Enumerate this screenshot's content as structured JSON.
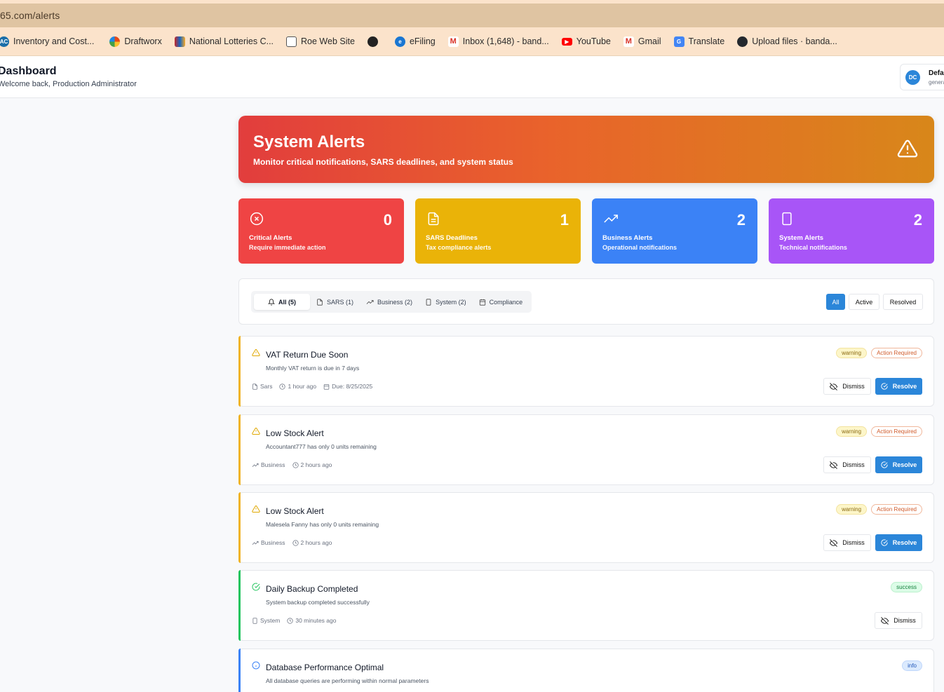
{
  "browser": {
    "url": "65.com/alerts",
    "bookmarks": [
      {
        "label": "Inventory and Cost...",
        "icon": "ac-icon",
        "color": "#1a6ea8"
      },
      {
        "label": "Draftworx",
        "icon": "draftworx-icon",
        "color": "#e64a19"
      },
      {
        "label": "National Lotteries C...",
        "icon": "lotteries-icon",
        "color": "#c62828"
      },
      {
        "label": "Roe Web Site",
        "icon": "roe-icon",
        "color": "#555555"
      },
      {
        "label": "",
        "icon": "globe-icon",
        "color": "#222222"
      },
      {
        "label": "eFiling",
        "icon": "efiling-icon",
        "color": "#1976d2"
      },
      {
        "label": "Inbox (1,648) - band...",
        "icon": "gmail-icon",
        "color": "#d93025"
      },
      {
        "label": "YouTube",
        "icon": "youtube-icon",
        "color": "#ff0000"
      },
      {
        "label": "Gmail",
        "icon": "gmail-icon",
        "color": "#d93025"
      },
      {
        "label": "Translate",
        "icon": "translate-icon",
        "color": "#4285f4"
      },
      {
        "label": "Upload files · banda...",
        "icon": "github-icon",
        "color": "#24292e"
      }
    ]
  },
  "header": {
    "title": "Dashboard",
    "subtitle": "Welcome back, Production Administrator",
    "user": {
      "initials": "DC",
      "name": "Defau",
      "role": "genera"
    }
  },
  "hero": {
    "title": "System Alerts",
    "subtitle": "Monitor critical notifications, SARS deadlines, and system status"
  },
  "stats": [
    {
      "label": "Critical Alerts",
      "desc": "Require immediate action",
      "count": "0",
      "color": "#ef4444",
      "icon": "x-circle-icon"
    },
    {
      "label": "SARS Deadlines",
      "desc": "Tax compliance alerts",
      "count": "1",
      "color": "#eab308",
      "icon": "file-icon"
    },
    {
      "label": "Business Alerts",
      "desc": "Operational notifications",
      "count": "2",
      "color": "#3b82f6",
      "icon": "trend-icon"
    },
    {
      "label": "System Alerts",
      "desc": "Technical notifications",
      "count": "2",
      "color": "#a855f7",
      "icon": "building-icon"
    }
  ],
  "filters": {
    "tabs": [
      "All (5)",
      "SARS (1)",
      "Business (2)",
      "System (2)",
      "Compliance"
    ],
    "status": [
      "All",
      "Active",
      "Resolved"
    ]
  },
  "alerts": [
    {
      "title": "VAT Return Due Soon",
      "desc": "Monthly VAT return is due in 7 days",
      "category": "Sars",
      "time": "1 hour ago",
      "due": "Due: 8/25/2025",
      "type": "warning",
      "action": "Action Required",
      "color": "#f0b429"
    },
    {
      "title": "Low Stock Alert",
      "desc": "Accountant777 has only 0 units remaining",
      "category": "Business",
      "time": "2 hours ago",
      "type": "warning",
      "action": "Action Required",
      "color": "#f0b429"
    },
    {
      "title": "Low Stock Alert",
      "desc": "Malesela Fanny has only 0 units remaining",
      "category": "Business",
      "time": "2 hours ago",
      "type": "warning",
      "action": "Action Required",
      "color": "#f0b429"
    },
    {
      "title": "Daily Backup Completed",
      "desc": "System backup completed successfully",
      "category": "System",
      "time": "30 minutes ago",
      "type": "success",
      "color": "#22c55e"
    },
    {
      "title": "Database Performance Optimal",
      "desc": "All database queries are performing within normal parameters",
      "type": "info",
      "color": "#3b82f6"
    }
  ],
  "buttons": {
    "dismiss": "Dismiss",
    "resolve": "Resolve"
  }
}
